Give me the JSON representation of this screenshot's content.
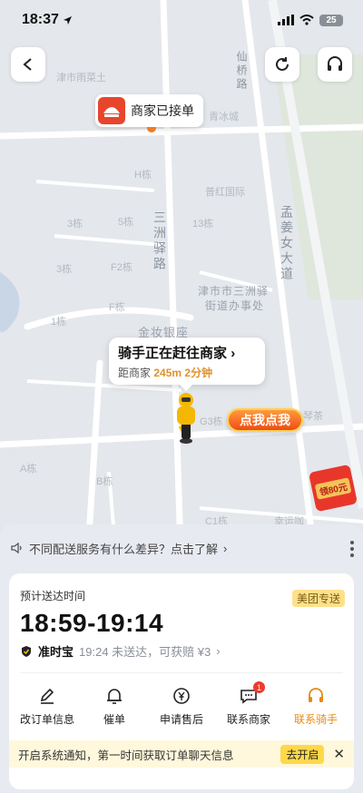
{
  "status": {
    "time": "18:37",
    "battery": "25"
  },
  "map": {
    "labels": [
      "津市雨菜土",
      "仙桥路",
      "青冰城",
      "H栋",
      "普红国际",
      "3栋",
      "5栋",
      "13栋",
      "三洲驿路",
      "孟姜女大道",
      "3栋",
      "F2栋",
      "F栋",
      "津市市三洲驿",
      "街道办事处",
      "1栋",
      "金妆银座",
      "G3栋",
      "A栋",
      "B栋",
      "C1栋",
      "琴茶",
      "幸运咖"
    ],
    "merchant_label": "商家已接单",
    "rider": {
      "title": "骑手正在赶往商家",
      "distance_prefix": "距商家",
      "distance": "245m",
      "eta": "2分钟"
    },
    "promo_button": "点我点我",
    "red_packet": "领80元"
  },
  "sheet": {
    "notice": "不同配送服务有什么差异？点击了解",
    "eta_label": "预计送达时间",
    "tag": "美团专送",
    "eta_time": "18:59-19:14",
    "guarantee_name": "准时宝",
    "guarantee_desc": "19:24 未送达，可获赔 ¥3",
    "actions": [
      {
        "label": "改订单信息",
        "icon": "edit-icon"
      },
      {
        "label": "催单",
        "icon": "bell-icon"
      },
      {
        "label": "申请售后",
        "icon": "yen-icon"
      },
      {
        "label": "联系商家",
        "icon": "chat-icon",
        "badge": "1"
      },
      {
        "label": "联系骑手",
        "icon": "headset-icon"
      }
    ],
    "system_notice": "开启系统通知，第一时间获取订单聊天信息",
    "system_notice_button": "去开启",
    "close": "✕"
  },
  "colors": {
    "accent": "#e58b16",
    "tag_bg": "#ffe08a",
    "promo": "#f04b16"
  }
}
